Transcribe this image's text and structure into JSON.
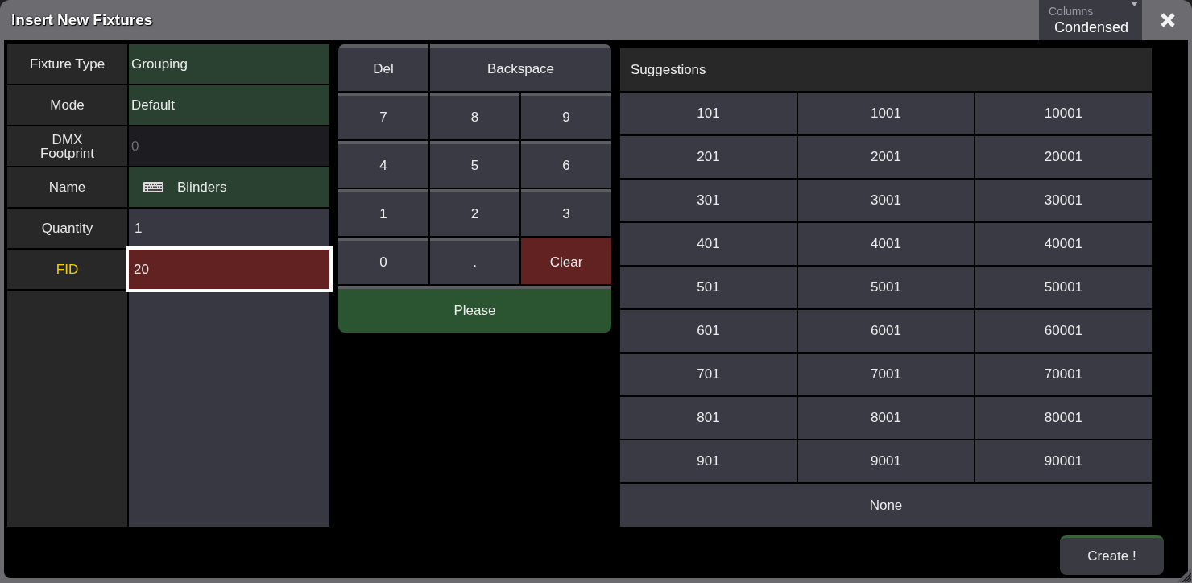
{
  "window": {
    "title": "Insert New Fixtures"
  },
  "columns_dropdown": {
    "label": "Columns",
    "value": "Condensed"
  },
  "properties": [
    {
      "label": "Fixture Type",
      "value": "Grouping",
      "kind": "choice",
      "disabled": false,
      "selected": false
    },
    {
      "label": "Mode",
      "value": "Default",
      "kind": "choice",
      "disabled": false,
      "selected": false
    },
    {
      "label": "DMX Footprint",
      "value": "0",
      "kind": "number",
      "disabled": true,
      "selected": false
    },
    {
      "label": "Name",
      "value": "Blinders",
      "kind": "text",
      "disabled": false,
      "selected": false
    },
    {
      "label": "Quantity",
      "value": "1",
      "kind": "number",
      "disabled": false,
      "selected": false
    },
    {
      "label": "FID",
      "value": "20",
      "kind": "number",
      "disabled": false,
      "selected": true
    }
  ],
  "keypad": {
    "keys": [
      {
        "label": "Del",
        "kind": "key"
      },
      {
        "label": "Backspace",
        "kind": "wide"
      },
      {
        "label": "7",
        "kind": "key"
      },
      {
        "label": "8",
        "kind": "key"
      },
      {
        "label": "9",
        "kind": "key"
      },
      {
        "label": "4",
        "kind": "key"
      },
      {
        "label": "5",
        "kind": "key"
      },
      {
        "label": "6",
        "kind": "key"
      },
      {
        "label": "1",
        "kind": "key"
      },
      {
        "label": "2",
        "kind": "key"
      },
      {
        "label": "3",
        "kind": "key"
      },
      {
        "label": "0",
        "kind": "key"
      },
      {
        "label": ".",
        "kind": "key"
      },
      {
        "label": "Clear",
        "kind": "clear"
      },
      {
        "label": "Please",
        "kind": "enter"
      }
    ]
  },
  "suggestions": {
    "title": "Suggestions",
    "items": [
      "101",
      "1001",
      "10001",
      "201",
      "2001",
      "20001",
      "301",
      "3001",
      "30001",
      "401",
      "4001",
      "40001",
      "501",
      "5001",
      "50001",
      "601",
      "6001",
      "60001",
      "701",
      "7001",
      "70001",
      "801",
      "8001",
      "80001",
      "901",
      "9001",
      "90001"
    ],
    "none_option": "None"
  },
  "create_button": {
    "label": "Create !"
  }
}
